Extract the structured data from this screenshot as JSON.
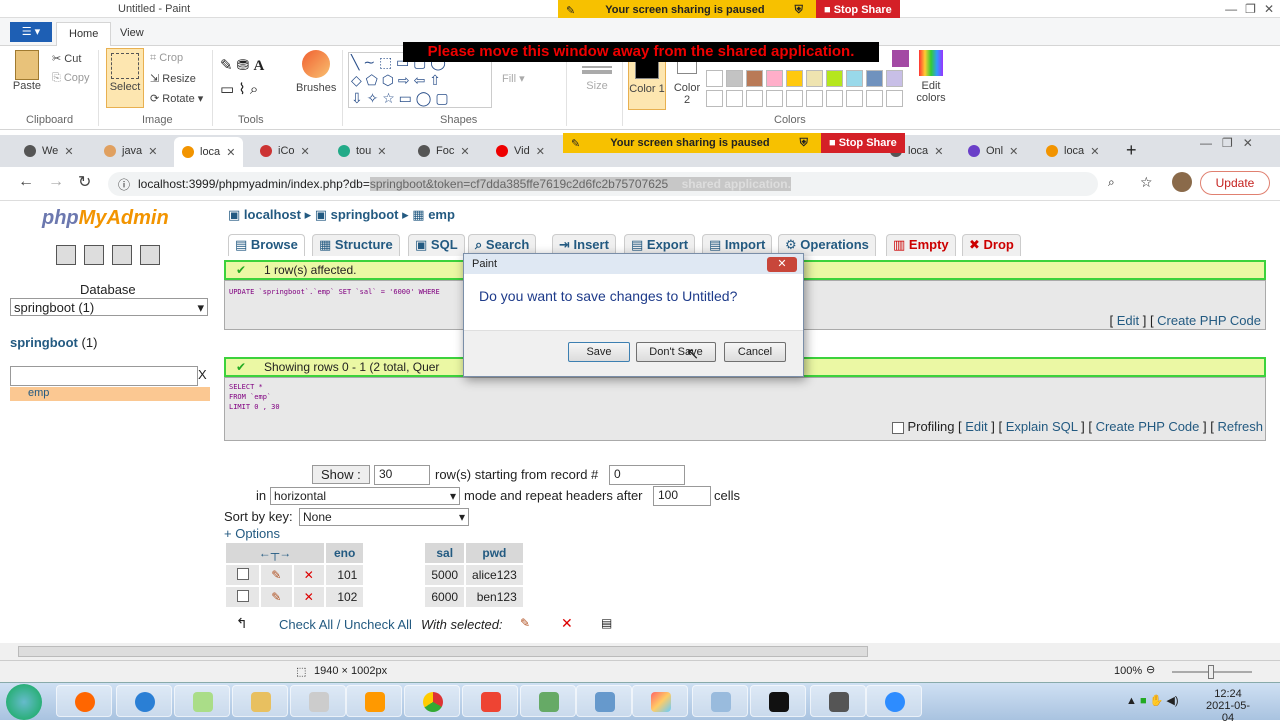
{
  "paint": {
    "title": "Untitled - Paint",
    "tabs": {
      "file": "☰ ▾",
      "home": "Home",
      "view": "View"
    },
    "clipboard": {
      "paste": "Paste",
      "cut": "Cut",
      "copy": "Copy",
      "label": "Clipboard"
    },
    "image": {
      "select": "Select",
      "crop": "Crop",
      "resize": "Resize",
      "rotate": "Rotate ▾",
      "label": "Image"
    },
    "tools_label": "Tools",
    "brushes": "Brushes",
    "shapes_label": "Shapes",
    "fill": "Fill ▾",
    "size": "Size",
    "color1": "Color 1",
    "color2": "Color 2",
    "colors_label": "Colors",
    "edit_colors": "Edit colors",
    "status_size": "1940 × 1002px",
    "zoom": "100%"
  },
  "share": {
    "paused": "Your screen sharing is paused",
    "stop": "Stop Share",
    "warning": "Please move this window away from the shared application."
  },
  "browser": {
    "tabs": [
      "We",
      "java",
      "loca",
      "iCo",
      "tou",
      "Foc",
      "Vid",
      "loca",
      "Onl",
      "loca"
    ],
    "url": "localhost:3999/phpmyadmin/index.php?db=",
    "url_hl": "springboot&token=cf7dda385ffe7619c2d6fc2b75707625",
    "url_tail": "shared application.",
    "update": "Update"
  },
  "pma": {
    "logo_a": "php",
    "logo_b": "MyAdmin",
    "db_label": "Database",
    "db_select": "springboot (1)",
    "db_name": "springboot",
    "db_count": "(1)",
    "table": "emp",
    "crumb": {
      "server": "localhost",
      "db": "springboot",
      "table": "emp"
    },
    "tabs": [
      "Browse",
      "Structure",
      "SQL",
      "Search",
      "Insert",
      "Export",
      "Import",
      "Operations",
      "Empty",
      "Drop"
    ],
    "msg1": "1 row(s) affected.",
    "sql1": "UPDATE `springboot`.`emp` SET `sal` = '6000' WHERE",
    "edit": "Edit",
    "create_php": "Create PHP Code",
    "msg2": "Showing rows 0 - 1 (2 total, Quer",
    "sql2": [
      "SELECT *",
      "FROM `emp`",
      "LIMIT 0 , 30"
    ],
    "profiling": "Profiling",
    "explain": "Explain SQL",
    "refresh": "Refresh",
    "show_btn": "Show :",
    "rows_val": "30",
    "rows_text": "row(s) starting from record #",
    "start_val": "0",
    "in": "in",
    "mode": "horizontal",
    "repeat_text": "mode and repeat headers after",
    "repeat_val": "100",
    "cells": "cells",
    "sort_label": "Sort by key:",
    "sort_val": "None",
    "options": "+ Options",
    "cols": [
      "eno",
      "sal",
      "pwd"
    ],
    "rows": [
      {
        "eno": "101",
        "sal": "5000",
        "pwd": "alice123"
      },
      {
        "eno": "102",
        "sal": "6000",
        "pwd": "ben123"
      }
    ],
    "check_all": "Check All / Uncheck All",
    "with_selected": "With selected:"
  },
  "dialog": {
    "title": "Paint",
    "message": "Do you want to save changes to Untitled?",
    "save": "Save",
    "dont_save": "Don't Save",
    "cancel": "Cancel"
  },
  "clock": {
    "time": "12:24",
    "date": "2021-05-04"
  }
}
